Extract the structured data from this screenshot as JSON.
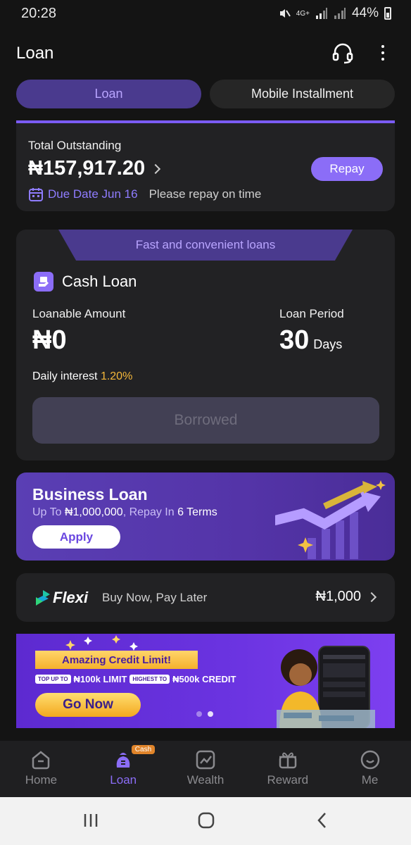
{
  "status": {
    "time": "20:28",
    "network": "4G+",
    "battery": "44%"
  },
  "header": {
    "title": "Loan"
  },
  "tabs": [
    {
      "label": "Loan",
      "active": true
    },
    {
      "label": "Mobile Installment",
      "active": false
    }
  ],
  "outstanding": {
    "label": "Total Outstanding",
    "amount": "₦157,917.20",
    "due_date": "Due Date Jun 16",
    "note": "Please repay on time",
    "repay_label": "Repay"
  },
  "cash_loan": {
    "banner": "Fast and convenient loans",
    "title": "Cash Loan",
    "loanable_label": "Loanable Amount",
    "loanable_value": "₦0",
    "period_label": "Loan Period",
    "period_value": "30",
    "period_unit": "Days",
    "daily_label": "Daily interest",
    "daily_rate": "1.20%",
    "button_label": "Borrowed"
  },
  "business_loan": {
    "title": "Business Loan",
    "sub_prefix": "Up To",
    "sub_amount": "₦1,000,000",
    "sub_mid": ", Repay In",
    "sub_terms": "6 Terms",
    "apply_label": "Apply"
  },
  "flexi": {
    "brand": "Flexi",
    "tagline": "Buy Now, Pay Later",
    "amount": "₦1,000"
  },
  "promo": {
    "ribbon": "Amazing Credit Limit!",
    "pill1": "TOP UP TO",
    "text1": "₦100k LIMIT",
    "pill2": "HIGHEST TO",
    "text2": "₦500k CREDIT",
    "cta": "Go Now"
  },
  "nav": {
    "items": [
      {
        "label": "Home",
        "icon": "home-icon"
      },
      {
        "label": "Loan",
        "icon": "loan-icon",
        "badge": "Cash",
        "active": true
      },
      {
        "label": "Wealth",
        "icon": "wealth-icon"
      },
      {
        "label": "Reward",
        "icon": "gift-icon"
      },
      {
        "label": "Me",
        "icon": "smile-icon"
      }
    ]
  },
  "colors": {
    "accent": "#8b6df7",
    "background": "#141414",
    "card": "#222224",
    "highlight": "#f5b83a"
  }
}
